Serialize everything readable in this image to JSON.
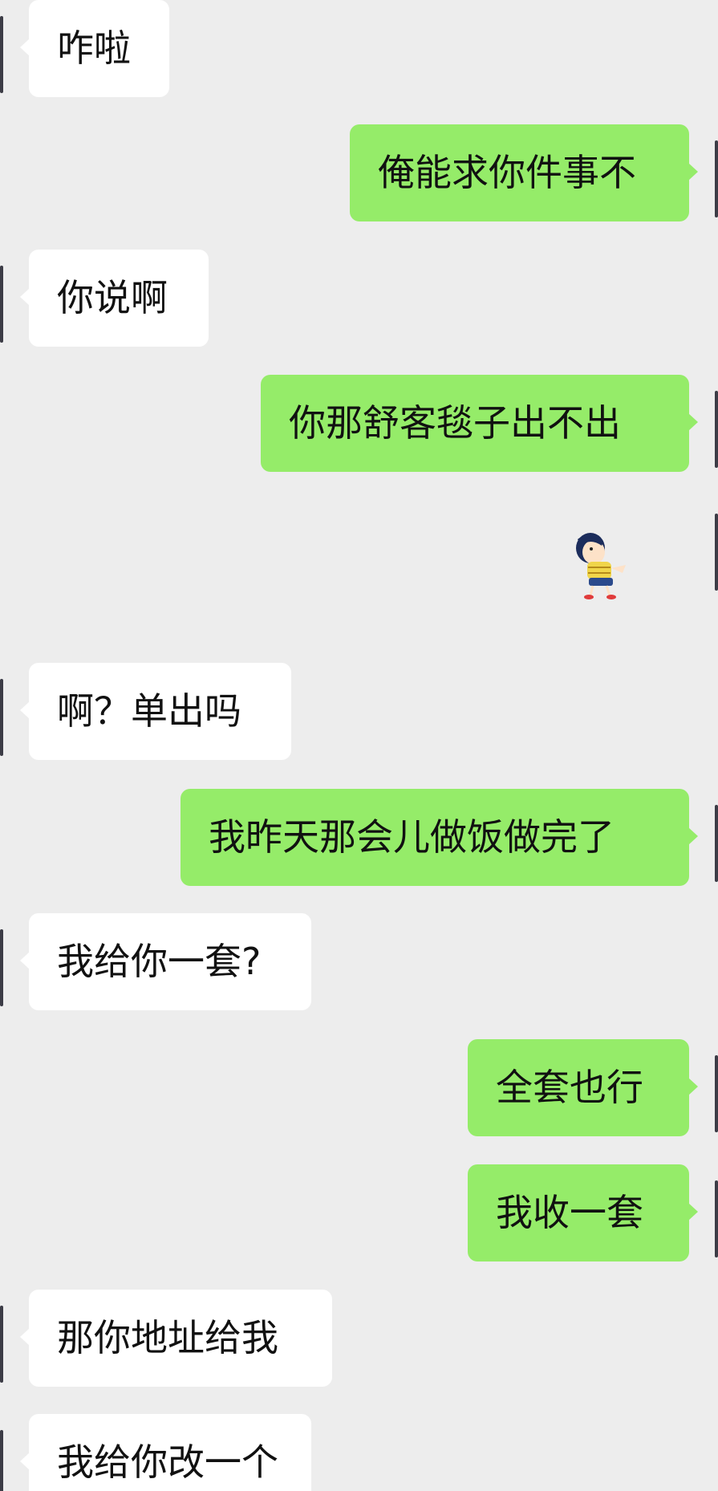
{
  "messages": [
    {
      "side": "left",
      "text": "咋啦"
    },
    {
      "side": "right",
      "text": "俺能求你件事不"
    },
    {
      "side": "left",
      "text": "你说啊"
    },
    {
      "side": "right",
      "text": "你那舒客毯子出不出"
    },
    {
      "side": "right",
      "type": "sticker",
      "sticker": "cartoon-boy-sticker"
    },
    {
      "side": "left",
      "text": "啊？单出吗"
    },
    {
      "side": "right",
      "text": "我昨天那会儿做饭做完了"
    },
    {
      "side": "left",
      "text": "我给你一套?"
    },
    {
      "side": "right",
      "text": "全套也行"
    },
    {
      "side": "right",
      "text": "我收一套"
    },
    {
      "side": "left",
      "text": "那你地址给我"
    },
    {
      "side": "left",
      "text": "我给你改一个"
    }
  ],
  "colors": {
    "background": "#ededed",
    "incoming_bubble": "#ffffff",
    "outgoing_bubble": "#95ec69",
    "text": "#111111"
  }
}
